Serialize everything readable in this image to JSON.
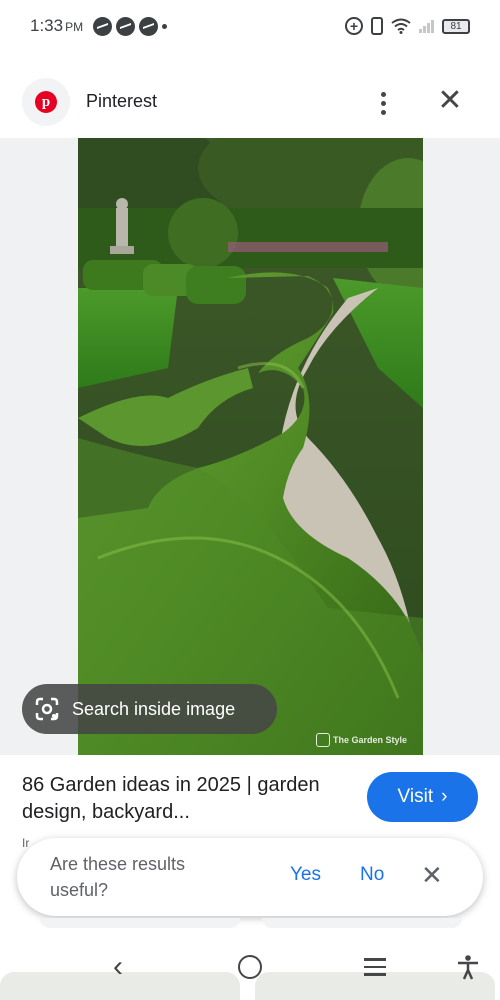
{
  "status_bar": {
    "time": "1:33",
    "ampm": "PM",
    "battery": "81",
    "icons": [
      "messenger-icon",
      "messenger-icon",
      "messenger-icon",
      "dot-icon",
      "add-circle-icon",
      "vibrate-icon",
      "wifi-icon",
      "signal-icon",
      "battery-icon"
    ]
  },
  "header": {
    "site_name": "Pinterest",
    "logo_letter": "p",
    "brand_color": "#e60023"
  },
  "image": {
    "watermark": "The Garden Style",
    "lens_label": "Search inside image"
  },
  "result": {
    "title": "86 Garden ideas in 2025 | garden design, backyard...",
    "visit_label": "Visit",
    "visit_chevron": "›",
    "source_peek": "Ir",
    "accent_color": "#1a73e8"
  },
  "feedback": {
    "question": "Are these results useful?",
    "yes": "Yes",
    "no": "No",
    "close": "✕"
  },
  "nav": {
    "back": "‹",
    "icons": [
      "back-icon",
      "home-icon",
      "recents-icon",
      "accessibility-icon"
    ]
  }
}
